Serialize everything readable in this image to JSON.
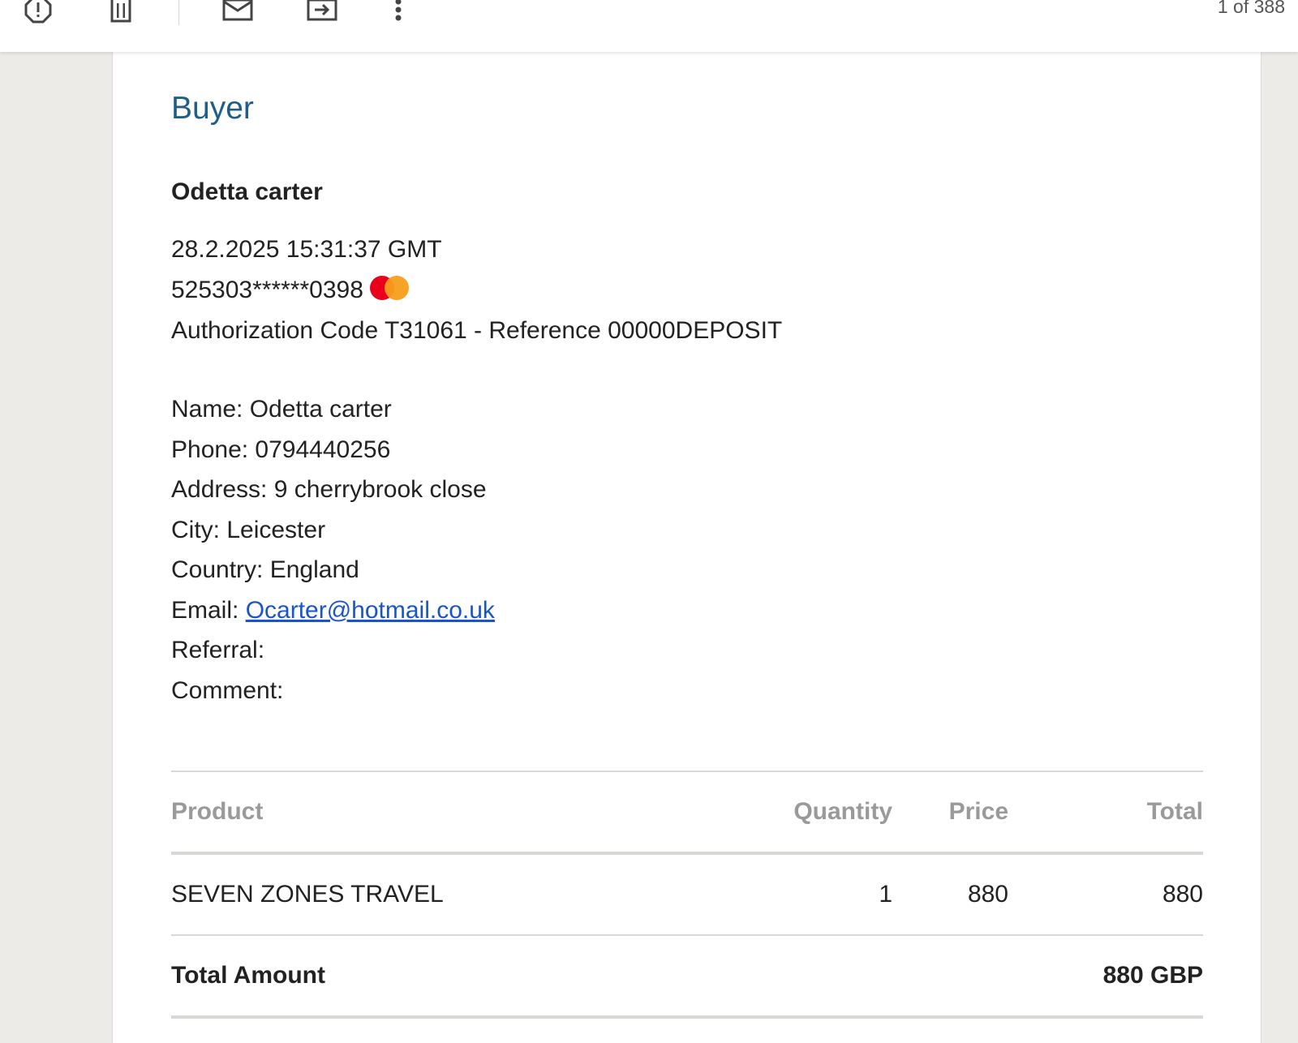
{
  "toolbar": {
    "icons": [
      "report-spam-icon",
      "delete-icon",
      "mark-unread-icon",
      "move-to-icon",
      "more-options-icon"
    ],
    "pager": "1 of 388"
  },
  "email": {
    "section_title": "Buyer",
    "buyer_name": "Odetta carter",
    "datetime": "28.2.2025 15:31:37 GMT",
    "card_number": "525303******0398",
    "card_brand_icon": "mastercard-icon",
    "authorization": "Authorization Code T31061 - Reference 00000DEPOSIT",
    "details": {
      "name": "Name: Odetta carter",
      "phone": "Phone: 0794440256",
      "address": "Address: 9 cherrybrook close",
      "city": "City: Leicester",
      "country": "Country: England",
      "email_label": "Email:",
      "email_value": "Ocarter@hotmail.co.uk",
      "referral": "Referral:",
      "comment": "Comment:"
    }
  },
  "order_table": {
    "headers": {
      "product": "Product",
      "quantity": "Quantity",
      "price": "Price",
      "total": "Total"
    },
    "rows": [
      {
        "product": "SEVEN ZONES TRAVEL",
        "quantity": "1",
        "price": "880",
        "total": "880"
      }
    ],
    "total_label": "Total Amount",
    "total_value": "880 GBP"
  },
  "colors": {
    "title": "#1f5e86",
    "link": "#1a55c7",
    "header_text": "#9a9a9a",
    "background": "#ecebe8"
  }
}
